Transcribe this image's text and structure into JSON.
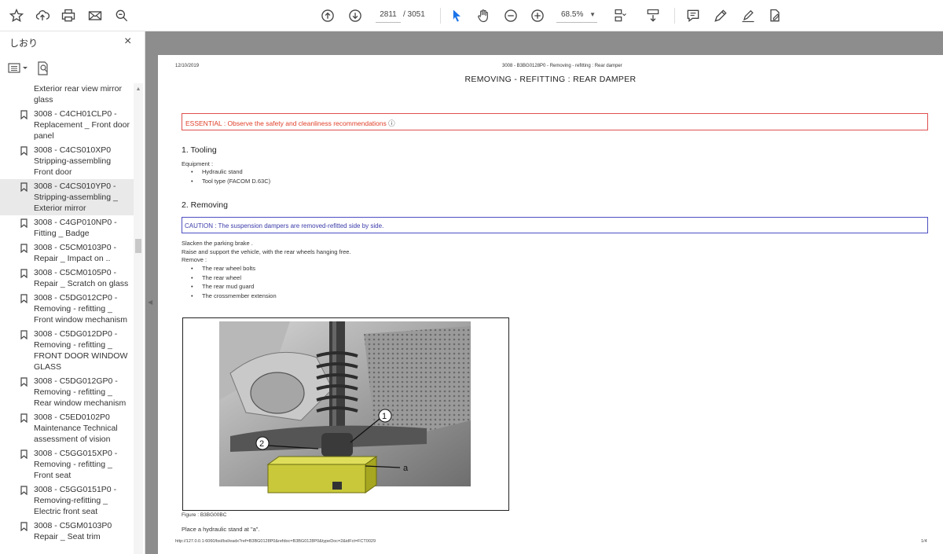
{
  "toolbar": {
    "current_page": "2811",
    "total_pages": "/ 3051",
    "zoom": "68.5%",
    "icons": [
      "star-icon",
      "upload-icon",
      "print-icon",
      "email-icon",
      "search-zoom-icon",
      "page-up-icon",
      "page-down-icon",
      "select-arrow-icon",
      "hand-icon",
      "zoom-out-icon",
      "zoom-in-icon",
      "fit-page-icon",
      "scroll-mode-icon",
      "comment-icon",
      "pen-icon",
      "sign-icon",
      "share-edit-icon"
    ]
  },
  "sidebar": {
    "title": "しおり",
    "close": "×",
    "items": [
      {
        "lines": [
          "Exterior rear view mirror",
          "glass"
        ],
        "top_cut": true
      },
      {
        "lines": [
          "3008 - C4CH01CLP0 -",
          "Replacement _ Front door",
          "panel"
        ]
      },
      {
        "lines": [
          "3008 - C4CS010XP0",
          "Stripping-assembling",
          "Front door"
        ]
      },
      {
        "lines": [
          "3008 - C4CS010YP0 -",
          "Stripping-assembling _",
          "Exterior mirror"
        ],
        "selected": true
      },
      {
        "lines": [
          "3008 - C4GP010NP0 -",
          "Fitting _ Badge"
        ]
      },
      {
        "lines": [
          "3008 - C5CM0103P0 -",
          "Repair _ Impact on .."
        ]
      },
      {
        "lines": [
          "3008 - C5CM0105P0 -",
          "Repair _ Scratch on glass"
        ]
      },
      {
        "lines": [
          "3008 - C5DG012CP0 -",
          "Removing - refitting _",
          "Front window mechanism"
        ]
      },
      {
        "lines": [
          "3008 - C5DG012DP0 -",
          "Removing - refitting _",
          "FRONT DOOR WINDOW",
          "GLASS"
        ]
      },
      {
        "lines": [
          "3008 - C5DG012GP0 -",
          "Removing - refitting _",
          "Rear window mechanism"
        ]
      },
      {
        "lines": [
          "3008 - C5ED0102P0",
          "Maintenance Technical",
          "assessment of vision"
        ]
      },
      {
        "lines": [
          "3008 - C5GG015XP0 -",
          "Removing - refitting _",
          "Front seat"
        ]
      },
      {
        "lines": [
          "3008 - C5GG0151P0 -",
          "Removing-refitting _",
          "Electric front seat"
        ]
      },
      {
        "lines": [
          "3008 - C5GM0103P0",
          "Repair _ Seat trim"
        ]
      }
    ]
  },
  "document": {
    "date": "12/10/2019",
    "breadcrumb": "3008 - B3BG0128P0 - Removing - refitting : Rear damper",
    "title": "REMOVING - REFITTING : REAR DAMPER",
    "essential_label": "ESSENTIAL",
    "essential_text": " : Observe the safety and cleanliness recommendations ",
    "section1": "1. Tooling",
    "equipment_label": "Equipment :",
    "tooling": [
      "Hydraulic stand",
      "Tool type (FACOM D.63C)"
    ],
    "section2": "2. Removing",
    "caution_label": "CAUTION",
    "caution_text": " : The suspension dampers are removed-refitted side by side.",
    "steps": [
      "Slacken the parking brake .",
      "Raise and support the vehicle, with the rear wheels hanging free.",
      "Remove :"
    ],
    "remove_list": [
      "The rear wheel bolts",
      "The rear wheel",
      "The rear mud guard",
      "The crossmember extension"
    ],
    "figure_labels": {
      "one": "1",
      "two": "2",
      "a": "a"
    },
    "figure_caption": "Figure : B3BG00BC",
    "after_figure": "Place a hydraulic stand at \"a\".",
    "footer_url": "http://127.0.0.1:6060/bsl/bsl/eadx?ref=B3BG0128P0&refdoc=B3BG0128P0&typeDoc=2&idFct=FCT0029",
    "footer_page": "1/4"
  },
  "colors": {
    "essential": "#e0402a",
    "caution": "#3a3aaa",
    "viewer_bg": "#8d8d8d",
    "accent_blue": "#1a73e8"
  }
}
